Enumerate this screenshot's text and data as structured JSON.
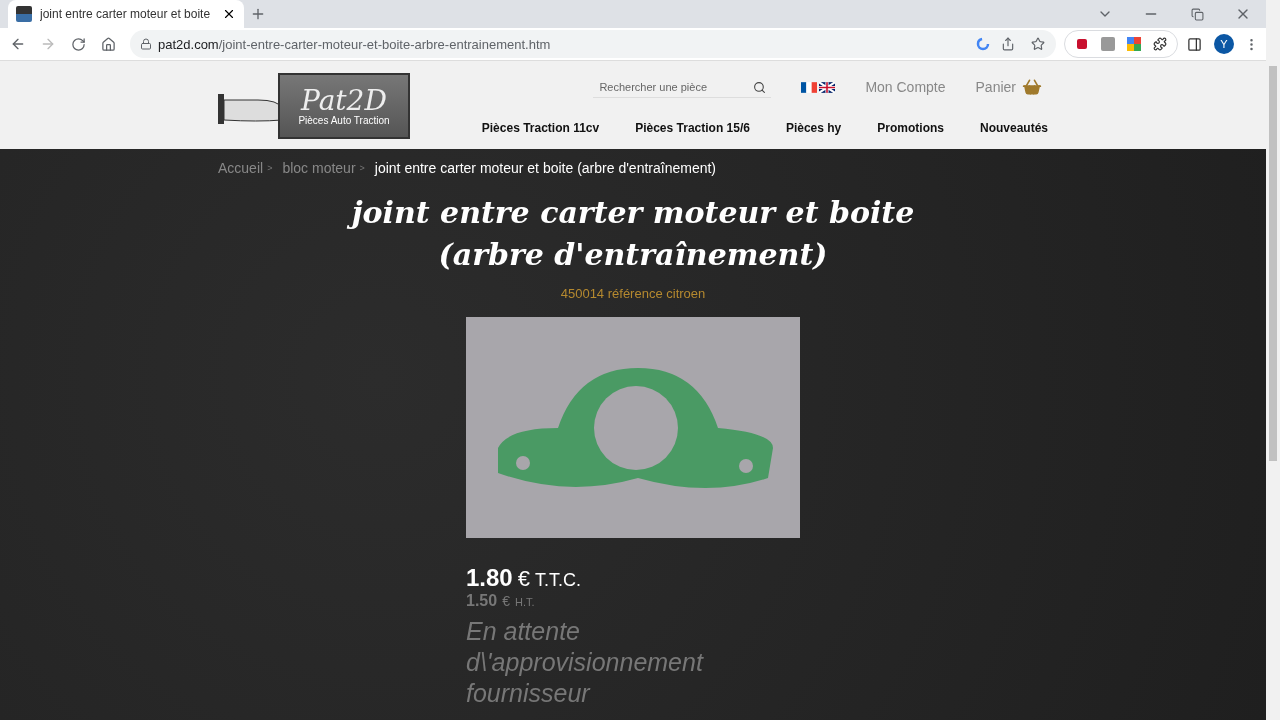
{
  "browser": {
    "tab": {
      "title": "joint entre carter moteur et boite",
      "selected": true
    },
    "url": {
      "domain": "pat2d.com",
      "path": "/joint-entre-carter-moteur-et-boite-arbre-entrainement.htm"
    },
    "profile": "Y"
  },
  "header": {
    "logo": {
      "name": "Pat2D",
      "tagline": "Pièces Auto Traction"
    },
    "search": {
      "placeholder": "Rechercher une pièce"
    },
    "account": "Mon Compte",
    "cart": "Panier",
    "nav": [
      "Pièces Traction 11cv",
      "Pièces Traction 15/6",
      "Pièces hy",
      "Promotions",
      "Nouveautés"
    ]
  },
  "breadcrumb": [
    {
      "label": "Accueil",
      "current": false,
      "separator": ">"
    },
    {
      "label": "bloc moteur",
      "current": false,
      "separator": ">"
    },
    {
      "label": "joint entre carter moteur et boite (arbre d'entraînement)",
      "current": true
    }
  ],
  "product": {
    "title": "joint entre carter moteur et boite (arbre d'entraînement)",
    "reference": "450014 référence citroen",
    "price_ttc": {
      "amount": "1.80",
      "currency": "€",
      "tax": "T.T.C."
    },
    "price_ht": {
      "amount": "1.50",
      "currency": "€",
      "tax": "H.T."
    },
    "availability": "En attente d\\'approvisionnement fournisseur"
  }
}
